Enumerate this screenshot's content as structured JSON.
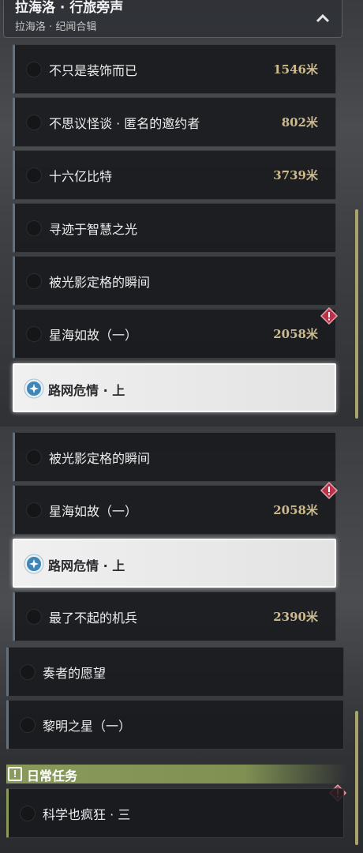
{
  "header": {
    "title": "拉海洛 · 行旅旁声",
    "subtitle": "拉海洛 · 纪闻合辑"
  },
  "top_quests": [
    {
      "name": "不只是装饰而已",
      "distance": "1546米"
    },
    {
      "name": "不思议怪谈 · 匿名的邀约者",
      "distance": "802米"
    },
    {
      "name": "十六亿比特",
      "distance": "3739米"
    },
    {
      "name": "寻迹于智慧之光",
      "distance": ""
    },
    {
      "name": "被光影定格的瞬间",
      "distance": ""
    },
    {
      "name": "星海如故（一）",
      "distance": "2058米"
    },
    {
      "name": "路网危情 · 上",
      "distance": ""
    }
  ],
  "bottom_quests": [
    {
      "name": "被光影定格的瞬间",
      "distance": ""
    },
    {
      "name": "星海如故（一）",
      "distance": "2058米"
    },
    {
      "name": "路网危情 · 上",
      "distance": ""
    },
    {
      "name": "最了不起的机兵",
      "distance": "2390米"
    },
    {
      "name": "奏者的愿望",
      "distance": ""
    },
    {
      "name": "黎明之星（一）",
      "distance": ""
    }
  ],
  "daily": {
    "section_label": "日常任务",
    "quests": [
      {
        "name": "科学也疯狂 · 三",
        "distance": ""
      }
    ]
  },
  "colors": {
    "accent_tracked": "#3e86b8",
    "warning": "#b8324a",
    "daily_bar": "#8a9a5c",
    "distance_text": "#cdbb8f"
  }
}
